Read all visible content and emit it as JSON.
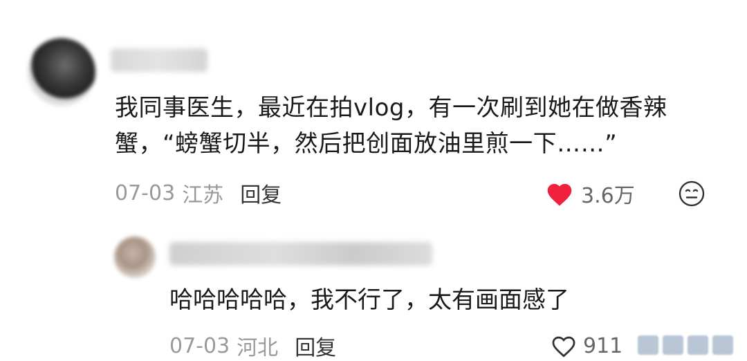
{
  "comments": [
    {
      "text": "我同事医生，最近在拍vlog，有一次刷到她在做香辣蟹，“螃蟹切半，然后把创面放油里煎一下……”",
      "date": "07-03",
      "location": "江苏",
      "reply_label": "回复",
      "likes": "3.6万",
      "liked": true,
      "like_color": "#f0213d"
    },
    {
      "text": "哈哈哈哈哈，我不行了，太有画面感了",
      "date": "07-03",
      "location": "河北",
      "reply_label": "回复",
      "likes": "911",
      "liked": false
    }
  ],
  "icons": {
    "like_filled": "heart-icon",
    "like_outline": "heart-outline-icon",
    "emoji": "neutral-face-icon"
  }
}
